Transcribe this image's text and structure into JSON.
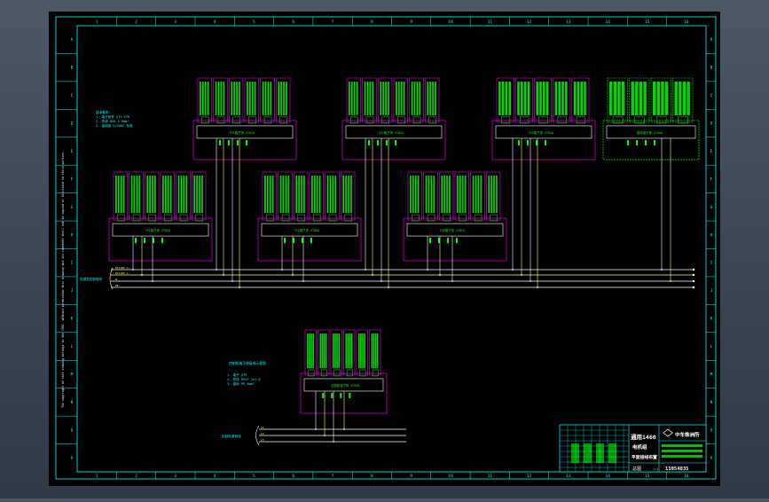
{
  "sheet": {
    "columns": [
      "1",
      "2",
      "3",
      "4",
      "5",
      "6",
      "7",
      "8",
      "9",
      "10",
      "11",
      "12",
      "13",
      "14",
      "15",
      "16"
    ],
    "rows": [
      "A",
      "B",
      "C",
      "D",
      "E",
      "F",
      "G",
      "H",
      "I",
      "J",
      "K",
      "L",
      "M",
      "N",
      "O",
      "P"
    ]
  },
  "left_margin_note": "The copyright of this drawing belongs to the CRRC. Without permission this drawing and its contents shall not be copied or disclosed to third parties.",
  "colors": {
    "frame": "#00ffff",
    "panel": "#e000e0",
    "device": "#00ff00",
    "bus_white": "#ffffff",
    "bus_yellow": "#ffff66",
    "note": "#00ffff"
  },
  "top_left_note": [
    "技术要求:",
    "1. 端子排号 XT1~XT6",
    "2. 导线 BVR 1.5mm²",
    "3. 接线按 Q/CRRC 标准"
  ],
  "bottom_note_title": "控制柜端子排接线示意图",
  "bottom_note_lines": [
    "1. 端子 XT9",
    "2. 导线 RVVP 2x1.0",
    "3. 接地 PE 4mm²"
  ],
  "bus_label_main": "电源及控制母线",
  "bus_label_lower": "控制电源母线",
  "bus_lines_main": [
    "DC110V L+",
    "DC110V L-",
    "N",
    "PE"
  ],
  "bus_lines_lower": [
    "L1",
    "L2",
    "L3"
  ],
  "panels": [
    {
      "label": "TP1端子排 XT01A"
    },
    {
      "label": "TP2端子排 XT02A"
    },
    {
      "label": "TP3端子排 XT03A"
    },
    {
      "label": "接地端子排 XT04A"
    },
    {
      "label": "TP4端子排 XT05A"
    },
    {
      "label": "TP5端子排 XT06A"
    },
    {
      "label": "TP6端子排 XT07A"
    },
    {
      "label": "控制柜端子排 XT09A"
    }
  ],
  "title_block": {
    "project": "通用1460",
    "line2": "电机组",
    "line3": "平面接线布置",
    "company": "中车株洲所",
    "drawing_no": "13054035",
    "scale": "1:1",
    "sheet": "总图"
  }
}
